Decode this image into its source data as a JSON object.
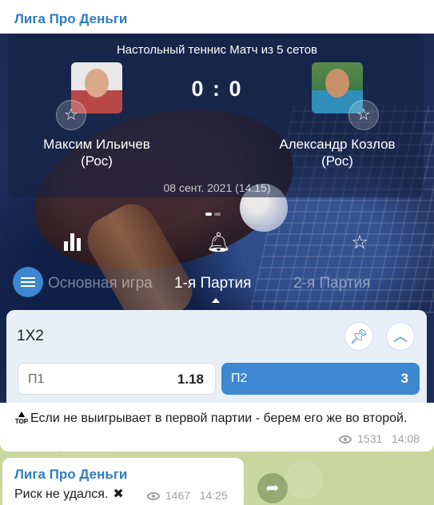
{
  "channel": {
    "name": "Лига Про Деньги"
  },
  "post1": {
    "media": {
      "match_title": "Настольный теннис Матч из 5 сетов",
      "score": "0 : 0",
      "player1": {
        "name_line1": "Максим Ильичев",
        "name_line2": "(Рос)"
      },
      "player2": {
        "name_line1": "Александр Козлов",
        "name_line2": "(Рос)"
      },
      "date": "08 сент. 2021 (14:15)",
      "tabs": {
        "main": "Основная игра",
        "first": "1-я Партия",
        "second": "2-я Партия"
      },
      "bet": {
        "title": "1X2",
        "p1_label": "П1",
        "p1_value": "1.18",
        "p2_label": "П2",
        "p2_value": "3"
      },
      "icons": [
        "stats-icon",
        "bell-icon",
        "star-icon",
        "menu-icon",
        "pin-icon",
        "chevron-up-icon"
      ]
    },
    "text_top_badge": "TOP",
    "text": "Если не выигрывает в первой партии - берем его же во второй.",
    "views": "1531",
    "time": "14:08"
  },
  "post2": {
    "text": "Риск не удался.",
    "views": "1467",
    "time": "14:25"
  },
  "colors": {
    "accent": "#2e7cc1",
    "odds_selected": "#3d88d0",
    "meta": "#a0a0a0"
  }
}
